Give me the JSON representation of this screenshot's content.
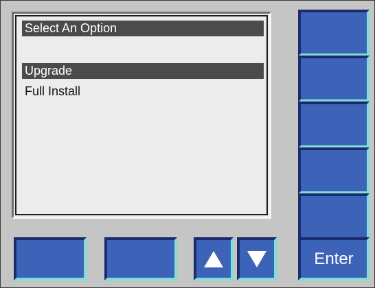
{
  "screen": {
    "title": "Select An Option",
    "options": [
      {
        "label": "Upgrade",
        "selected": true
      },
      {
        "label": "Full Install",
        "selected": false
      }
    ]
  },
  "buttons": {
    "enter_label": "Enter",
    "up_icon": "triangle-up",
    "down_icon": "triangle-down"
  },
  "colors": {
    "panel": "#c5c5c5",
    "screen": "#ececec",
    "highlight": "#4b4b4b",
    "button": "#3d63b8",
    "button_bevel_light": "#7de0d6",
    "button_bevel_dark": "#1c2a6e"
  }
}
